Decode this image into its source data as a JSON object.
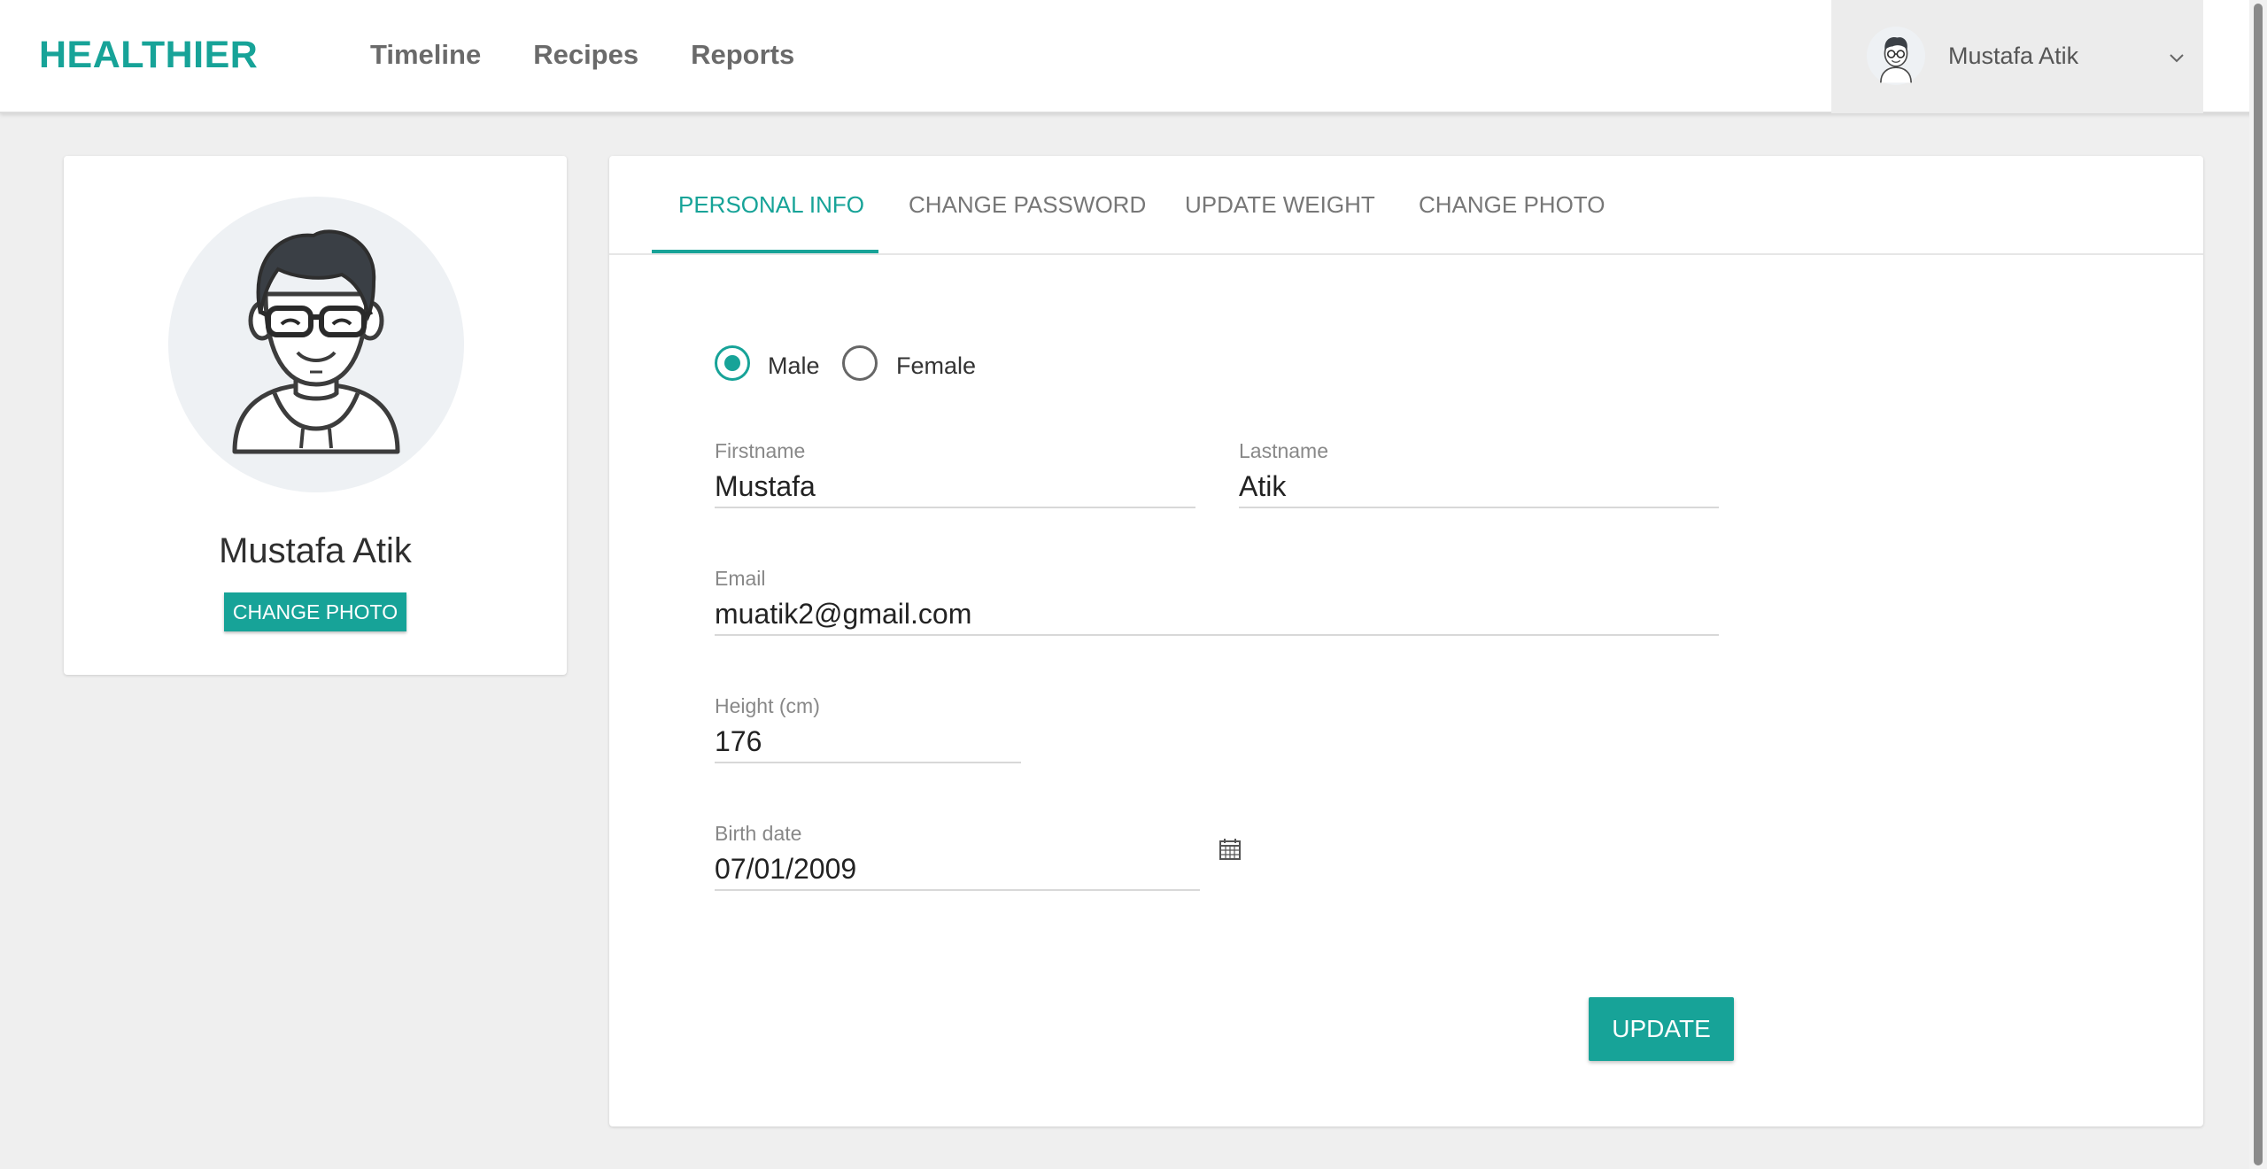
{
  "brand": "HEALTHIER",
  "nav": [
    "Timeline",
    "Recipes",
    "Reports"
  ],
  "user": {
    "name": "Mustafa Atik"
  },
  "profile": {
    "name": "Mustafa Atik",
    "change_photo_label": "CHANGE PHOTO"
  },
  "tabs": [
    "PERSONAL INFO",
    "CHANGE PASSWORD",
    "UPDATE WEIGHT",
    "CHANGE PHOTO"
  ],
  "form": {
    "gender": {
      "selected": "Male",
      "options": [
        "Male",
        "Female"
      ]
    },
    "firstname": {
      "label": "Firstname",
      "value": "Mustafa"
    },
    "lastname": {
      "label": "Lastname",
      "value": "Atik"
    },
    "email": {
      "label": "Email",
      "value": "muatik2@gmail.com"
    },
    "height": {
      "label": "Height (cm)",
      "value": "176"
    },
    "birthdate": {
      "label": "Birth date",
      "value": "07/01/2009"
    },
    "update_label": "UPDATE"
  },
  "colors": {
    "accent": "#17a398",
    "background": "#efefef"
  }
}
